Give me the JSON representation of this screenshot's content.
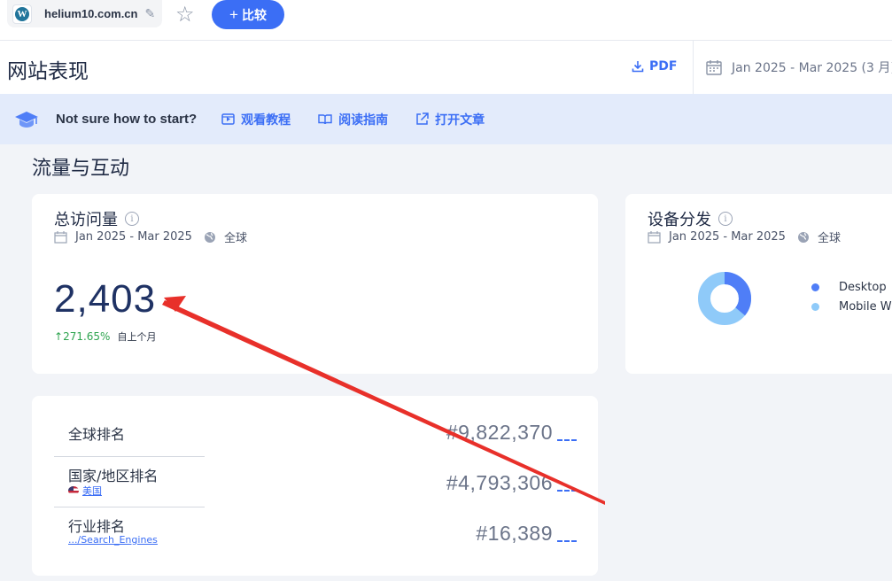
{
  "topbar": {
    "site_domain": "helium10.com.cn",
    "compare_label": "比较",
    "compare_plus": "+"
  },
  "header": {
    "title": "网站表现",
    "pdf_label": "PDF",
    "date_range": "Jan 2025 - Mar 2025 (3 月)"
  },
  "banner": {
    "prompt": "Not sure how to start?",
    "links": [
      {
        "label": "观看教程",
        "icon": "video-icon"
      },
      {
        "label": "阅读指南",
        "icon": "book-icon"
      },
      {
        "label": "打开文章",
        "icon": "external-link-icon"
      }
    ]
  },
  "section": {
    "title": "流量与互动"
  },
  "visits_card": {
    "title": "总访问量",
    "date": "Jan 2025 - Mar 2025",
    "region": "全球",
    "value": "2,403",
    "change": "271.65%",
    "change_label": "自上个月"
  },
  "device_card": {
    "title": "设备分发",
    "date": "Jan 2025 - Mar 2025",
    "region": "全球",
    "legend": [
      {
        "label": "Desktop",
        "color": "#4f7ef7"
      },
      {
        "label": "Mobile W",
        "color": "#8fcaf9"
      }
    ],
    "desktop_share": 0.36
  },
  "ranks_card": {
    "rows": [
      {
        "label": "全球排名",
        "sub": "",
        "value": "#9,822,370"
      },
      {
        "label": "国家/地区排名",
        "sub": "美国",
        "value": "#4,793,306"
      },
      {
        "label": "行业排名",
        "sub": ".../Search_Engines",
        "value": "#16,389"
      }
    ]
  },
  "colors": {
    "accent": "#3b6ef5",
    "annotation_arrow": "#e8302a",
    "positive": "#2ea44f"
  }
}
